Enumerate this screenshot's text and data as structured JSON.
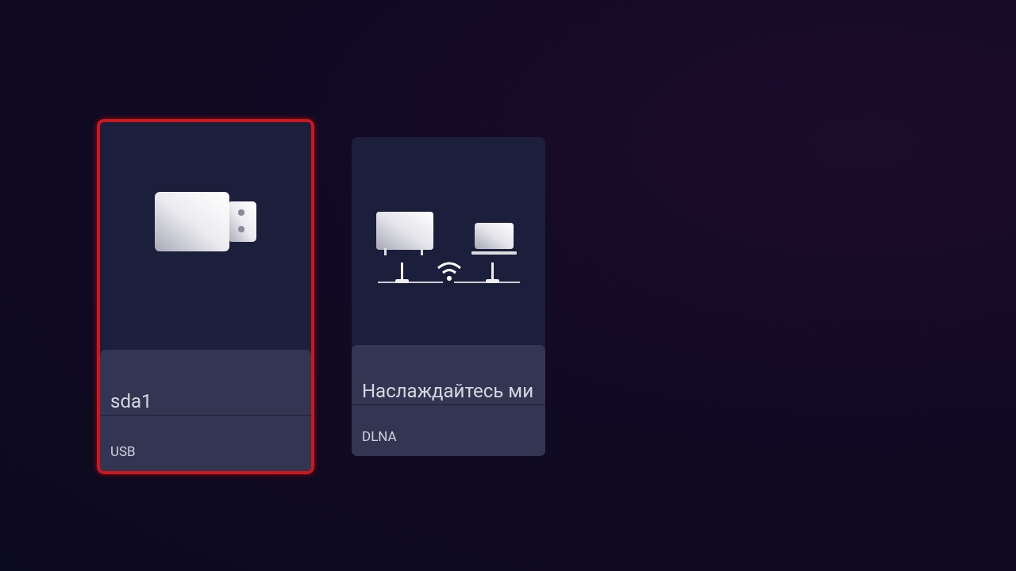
{
  "cards": [
    {
      "kind": "usb",
      "title": "sda1",
      "subtitle": "USB",
      "selected": true
    },
    {
      "kind": "dlna",
      "title": "Наслаждайтесь ми",
      "subtitle": "DLNA",
      "selected": false
    }
  ]
}
